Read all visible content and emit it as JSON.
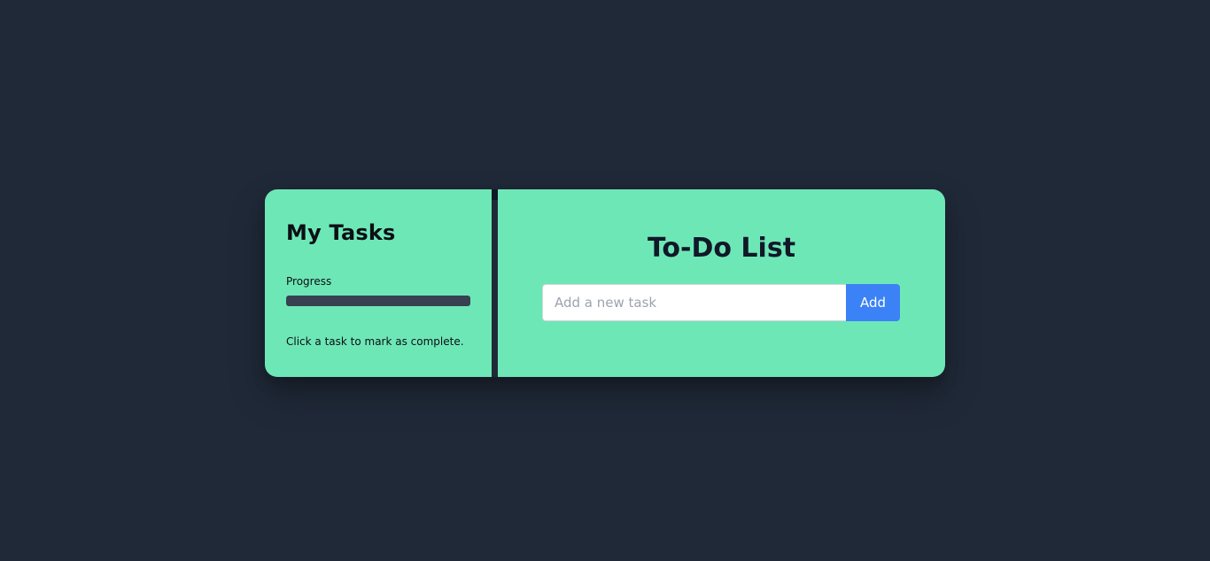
{
  "sidebar": {
    "title": "My Tasks",
    "progress_label": "Progress",
    "progress_value": 0,
    "hint": "Click a task to mark as complete."
  },
  "main": {
    "title": "To-Do List",
    "input": {
      "placeholder": "Add a new task",
      "value": ""
    },
    "add_label": "Add"
  },
  "colors": {
    "background": "#202938",
    "panel": "#6ee7b7",
    "accent": "#3b82f6",
    "progress_track": "#374151"
  }
}
